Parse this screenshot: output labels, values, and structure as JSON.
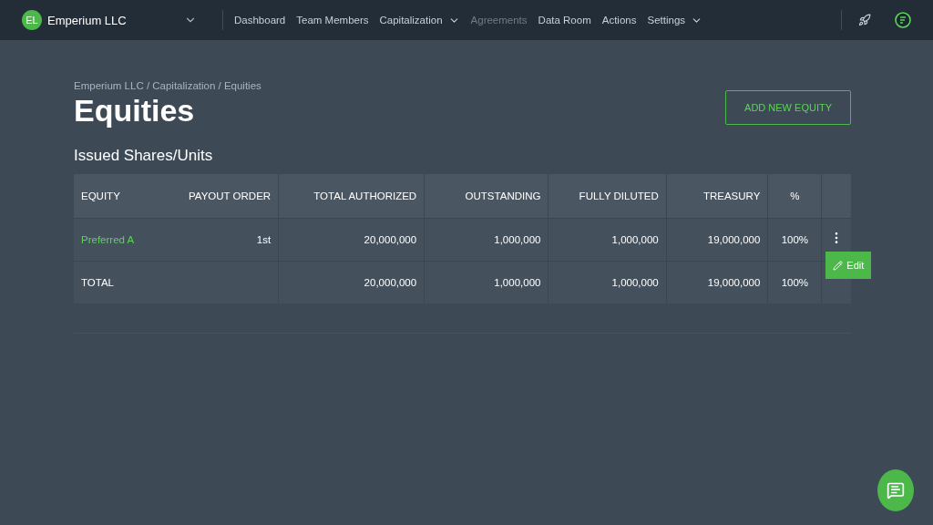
{
  "company": {
    "initials": "EL",
    "name": "Emperium LLC"
  },
  "nav": [
    {
      "label": "Dashboard",
      "disabled": false,
      "has_menu": false
    },
    {
      "label": "Team Members",
      "disabled": false,
      "has_menu": false
    },
    {
      "label": "Capitalization",
      "disabled": false,
      "has_menu": true
    },
    {
      "label": "Agreements",
      "disabled": true,
      "has_menu": false
    },
    {
      "label": "Data Room",
      "disabled": false,
      "has_menu": false
    },
    {
      "label": "Actions",
      "disabled": false,
      "has_menu": false
    },
    {
      "label": "Settings",
      "disabled": false,
      "has_menu": true
    }
  ],
  "breadcrumb": "Emperium LLC / Capitalization / Equities",
  "title": "Equities",
  "add_button": "ADD NEW EQUITY",
  "section_title": "Issued Shares/Units",
  "table": {
    "columns": [
      "EQUITY",
      "PAYOUT ORDER",
      "TOTAL AUTHORIZED",
      "OUTSTANDING",
      "FULLY DILUTED",
      "TREASURY",
      "%"
    ],
    "rows": [
      {
        "kind": "item",
        "cells": [
          "Preferred A",
          "1st",
          "20,000,000",
          "1,000,000",
          "1,000,000",
          "19,000,000",
          "100%"
        ],
        "menu": {
          "label": "Edit"
        }
      },
      {
        "kind": "total",
        "cells": [
          "TOTAL",
          "",
          "20,000,000",
          "1,000,000",
          "1,000,000",
          "19,000,000",
          "100%"
        ]
      }
    ]
  }
}
